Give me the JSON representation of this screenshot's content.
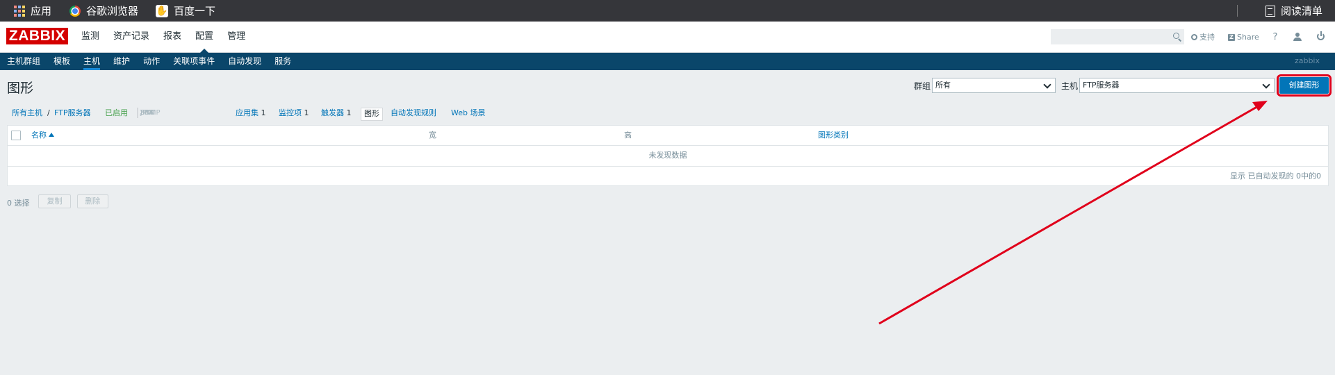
{
  "browser_bar": {
    "apps_label": "应用",
    "chrome_label": "谷歌浏览器",
    "baidu_label": "百度一下",
    "reading_list_label": "阅读清单"
  },
  "header": {
    "logo": "ZABBIX",
    "main_menu": [
      "监测",
      "资产记录",
      "报表",
      "配置",
      "管理"
    ],
    "active_menu": "配置",
    "search_value": "",
    "support_label": "支持",
    "share_label": "Share",
    "help_label": "?"
  },
  "submenu": {
    "items": [
      "主机群组",
      "模板",
      "主机",
      "维护",
      "动作",
      "关联项事件",
      "自动发现",
      "服务"
    ],
    "active": "主机",
    "brand": "zabbix"
  },
  "page": {
    "title": "图形",
    "group_label": "群组",
    "group_value": "所有",
    "host_label": "主机",
    "host_value": "FTP服务器",
    "create_button": "创建图形"
  },
  "breadcrumb": {
    "all_hosts": "所有主机",
    "sep": "/",
    "host": "FTP服务器",
    "enabled": "已启用",
    "statuses": [
      "ZBX",
      "SNMP",
      "JMX",
      "IPMI"
    ],
    "applications": "应用集",
    "applications_count": "1",
    "items": "监控项",
    "items_count": "1",
    "triggers": "触发器",
    "triggers_count": "1",
    "graphs": "图形",
    "discovery": "自动发现规则",
    "web": "Web 场景"
  },
  "table": {
    "columns": [
      "名称",
      "宽",
      "高",
      "图形类别"
    ],
    "empty_text": "未发现数据",
    "footer": "显示 已自动发现的 0中的0"
  },
  "actions": {
    "selected": "0 选择",
    "copy": "复制",
    "delete": "删除"
  },
  "colors": {
    "nav_bg": "#0a466a",
    "accent": "#0275b8",
    "logo_red": "#d40000",
    "annotation_red": "#e0001b"
  }
}
